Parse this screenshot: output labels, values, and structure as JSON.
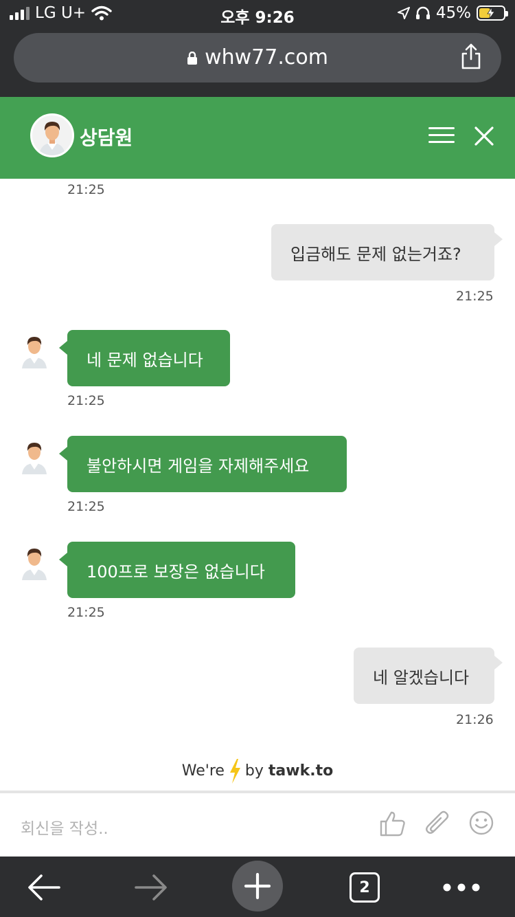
{
  "status_bar": {
    "carrier": "LG U+",
    "time": "오후 9:26",
    "battery": "45%"
  },
  "browser": {
    "url": "whw77.com",
    "tab_count": "2"
  },
  "chat": {
    "agent_name": "상담원",
    "first_timestamp": "21:25",
    "messages": [
      {
        "sender": "visitor",
        "text": "입금해도 문제 없는거죠?",
        "time": "21:25"
      },
      {
        "sender": "agent",
        "text": "네 문제 없습니다",
        "time": "21:25"
      },
      {
        "sender": "agent",
        "text": "불안하시면 게임을 자제해주세요",
        "time": "21:25"
      },
      {
        "sender": "agent",
        "text": "100프로 보장은 없습니다",
        "time": "21:25"
      },
      {
        "sender": "visitor",
        "text": "네 알겠습니다",
        "time": "21:26"
      }
    ],
    "powered_by": {
      "prefix": "We're",
      "middle": "by",
      "brand": "tawk.to"
    },
    "composer_placeholder": "회신을 작성.."
  },
  "colors": {
    "header_green": "#44a153",
    "agent_bubble": "#439a4e",
    "visitor_bubble": "#e6e6e6",
    "chrome_dark": "#2d2e30",
    "bolt_yellow": "#f5c518"
  }
}
